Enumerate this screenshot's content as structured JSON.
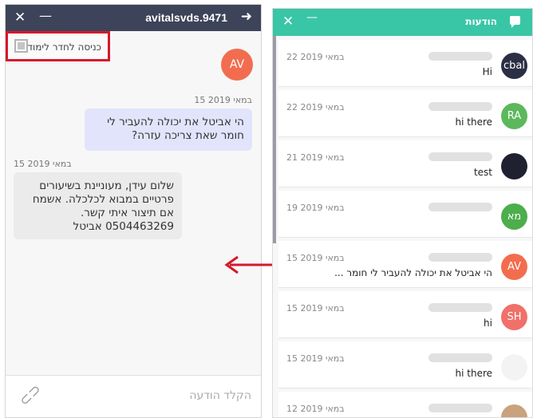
{
  "chat": {
    "close_icon": "close-icon",
    "minimize_icon": "minimize-icon",
    "title": "avitalsvds.9471",
    "forward_icon": "arrow-right-icon",
    "enter_room_label": "כניסה לחדר לימוד",
    "avatar_initials": "AV",
    "messages": [
      {
        "timestamp": "15 במאי 2019",
        "text": "הי אביטל את יכולה להעביר לי חומר שאת צריכה עזרה?",
        "sender": "me"
      },
      {
        "timestamp": "15 במאי 2019",
        "text": "שלום עידן, מעוניינת בשיעורים פרטיים במבוא לכלכלה. אשמח אם תיצור איתי קשר. 0504463269 אביטל",
        "sender": "them"
      }
    ],
    "input_placeholder": "הקלד הודעה",
    "attach_icon": "paperclip-icon"
  },
  "colors": {
    "chat_header": "#3d4358",
    "list_header": "#39c6a6",
    "highlight_box": "#d6182b",
    "arrow": "#d6182b",
    "my_bubble": "#e2e4fb",
    "their_bubble": "#ebebeb"
  },
  "list": {
    "title": "הודעות",
    "header_icon": "message-icon",
    "close_icon": "close-icon",
    "minimize_icon": "minimize-icon",
    "rows": [
      {
        "timestamp": "22 במאי 2019",
        "message": "Hi",
        "avatar": "cbal",
        "avatar_color": "#2b2f45"
      },
      {
        "timestamp": "22 במאי 2019",
        "message": "hi there",
        "avatar": "RA",
        "avatar_color": "#5cb85c"
      },
      {
        "timestamp": "21 במאי 2019",
        "message": "test",
        "avatar": "",
        "avatar_color": "#1f2130"
      },
      {
        "timestamp": "19 במאי 2019",
        "message": "",
        "avatar": "מא",
        "avatar_color": "#4cae4c"
      },
      {
        "timestamp": "15 במאי 2019",
        "message": "הי אביטל את יכולה להעביר לי חומר ...",
        "avatar": "AV",
        "avatar_color": "#f26d4f"
      },
      {
        "timestamp": "15 במאי 2019",
        "message": "hi",
        "avatar": "SH",
        "avatar_color": "#f0706a"
      },
      {
        "timestamp": "15 במאי 2019",
        "message": "hi there",
        "avatar": "",
        "avatar_color": "#f3f3f3"
      },
      {
        "timestamp": "12 במאי 2019",
        "message": "",
        "avatar": "",
        "avatar_color": "#c9a27e"
      }
    ]
  }
}
